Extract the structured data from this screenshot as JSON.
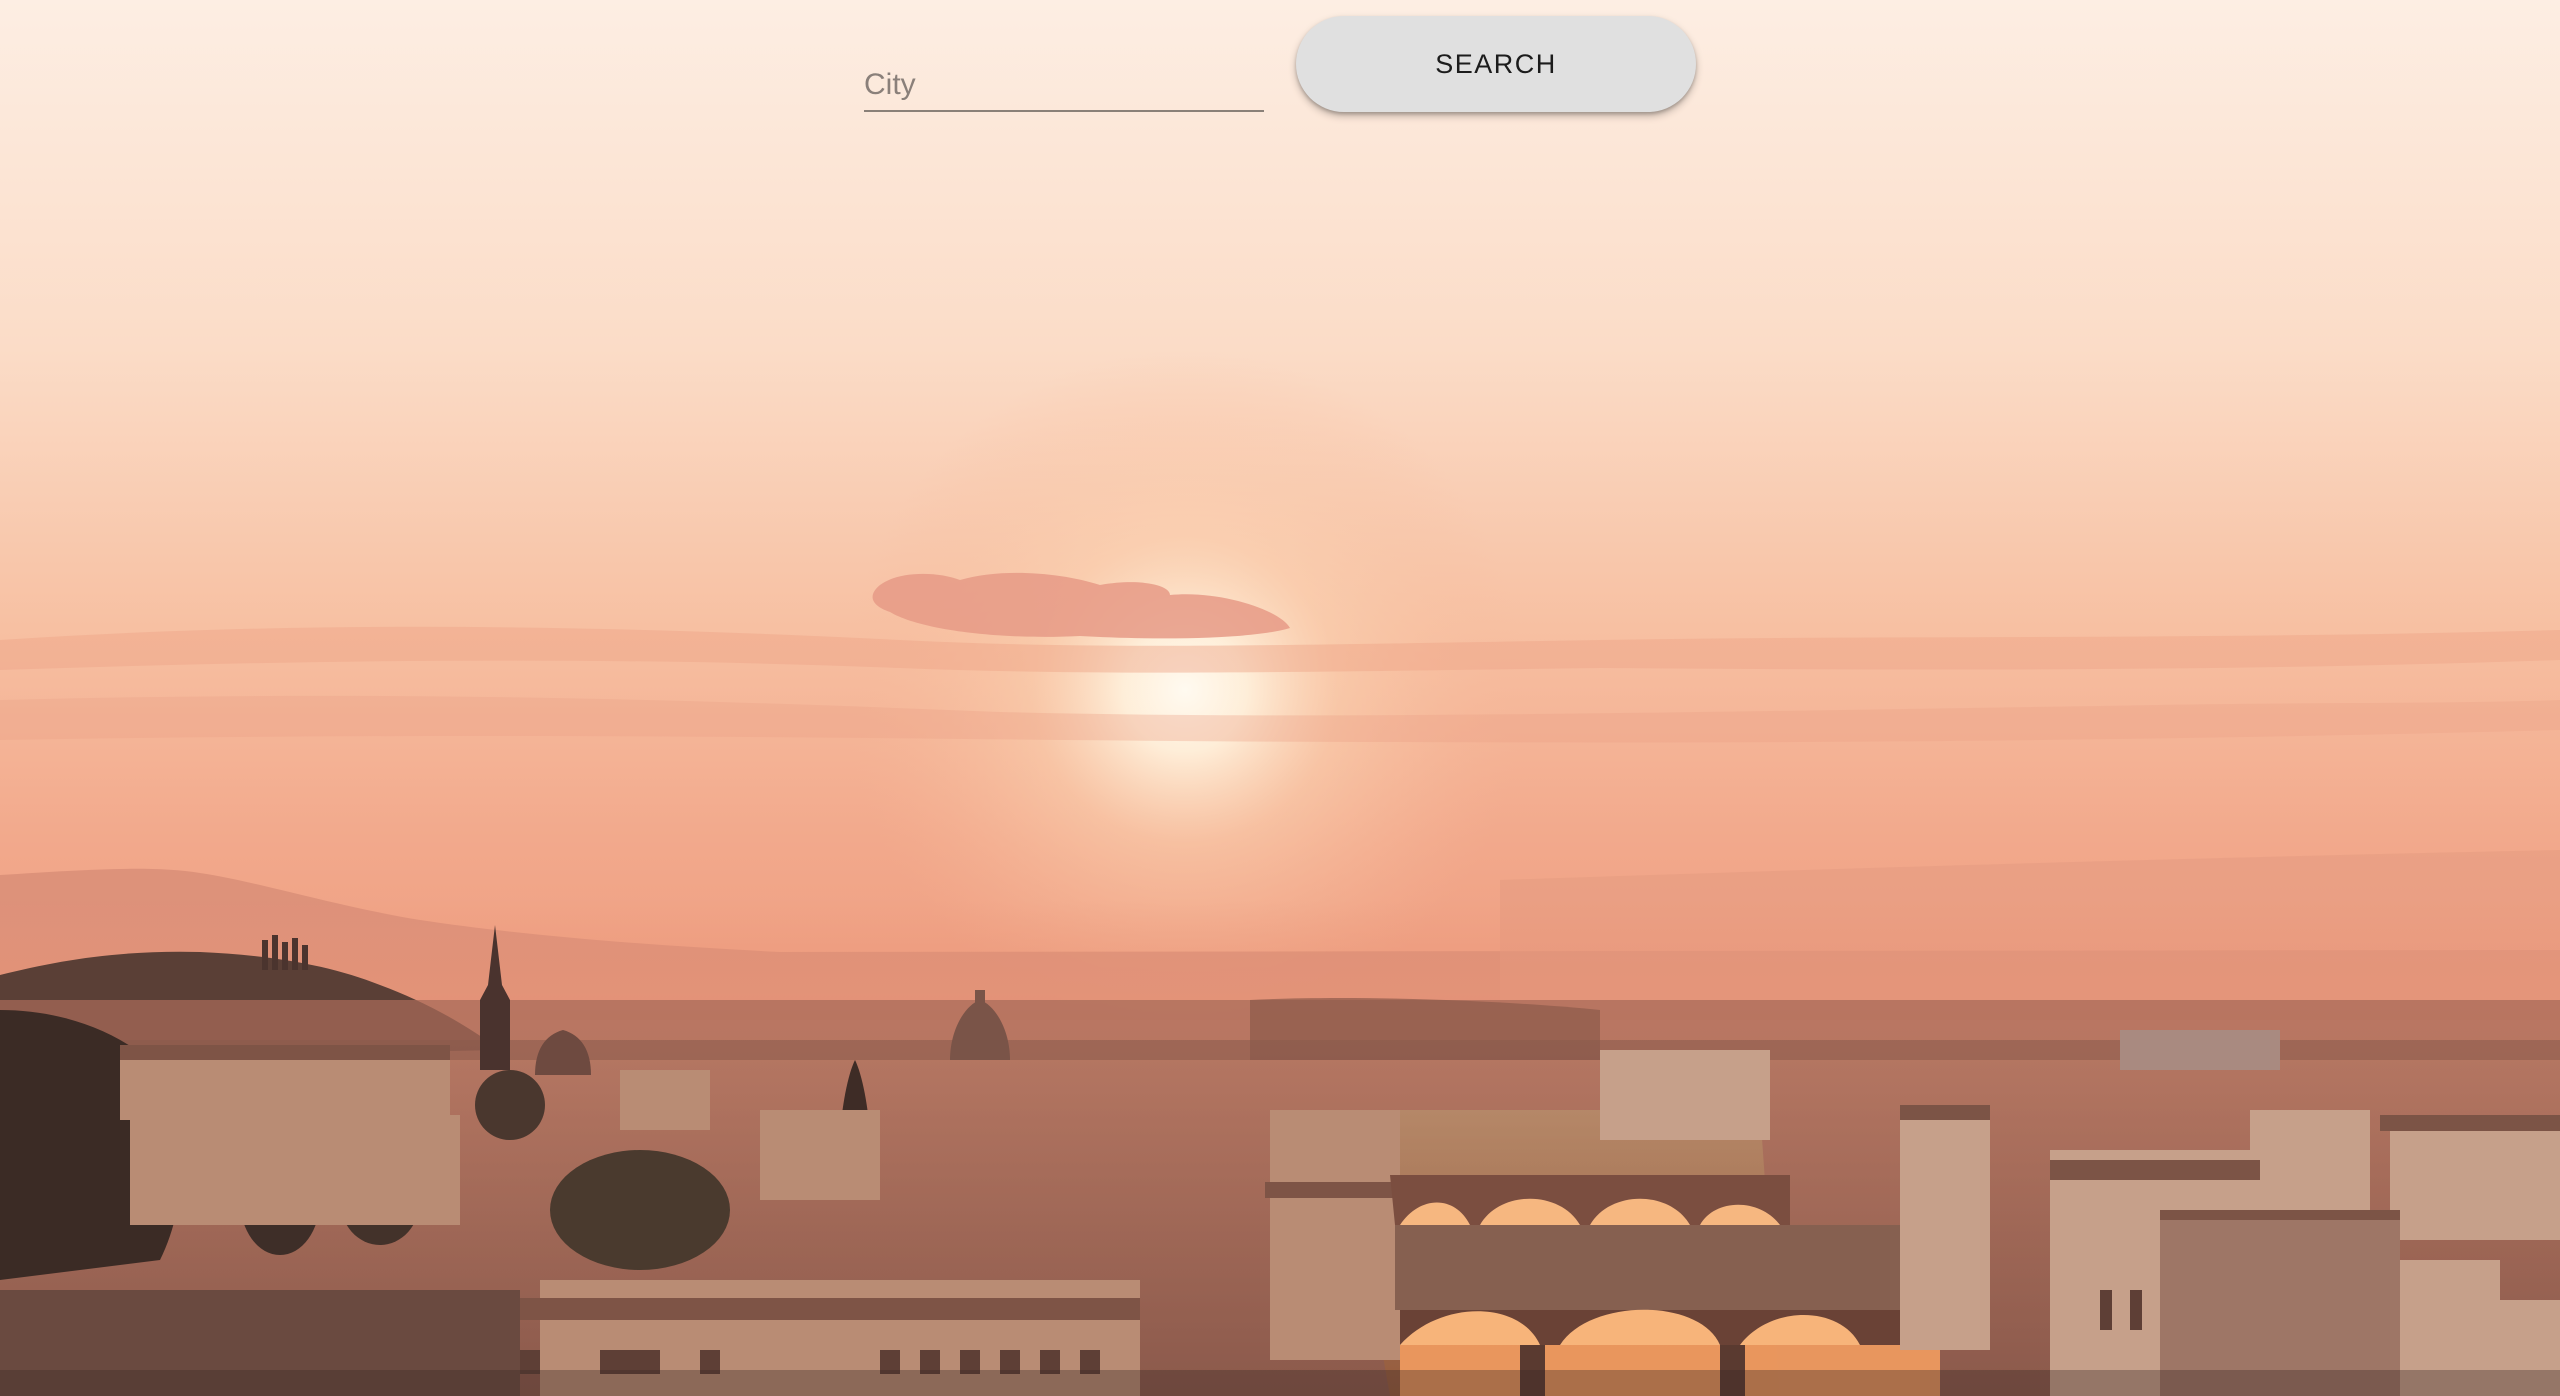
{
  "search": {
    "city_placeholder": "City",
    "city_value": "",
    "button_label": "SEARCH"
  },
  "background": {
    "sky_top": "#fdece0",
    "sky_mid": "#f7c2a0",
    "sky_horizon": "#ef9a78",
    "sun": "#fff6e6",
    "city_dark": "#3c2a26",
    "river": "#f7b070"
  }
}
